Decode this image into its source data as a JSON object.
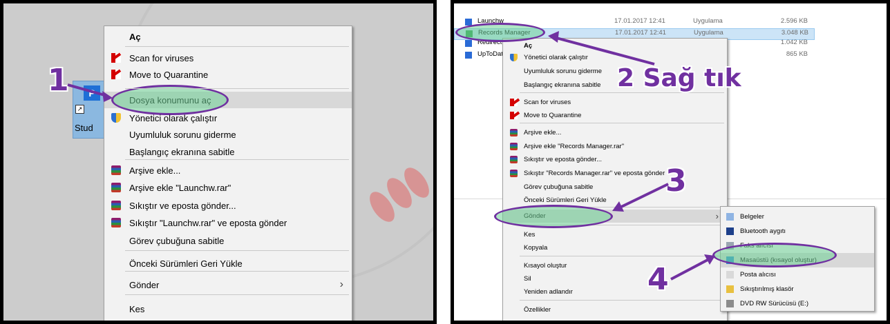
{
  "left": {
    "step": "1",
    "desktop_icon": {
      "label": "Stud",
      "tile_letter": "P"
    },
    "menu_items": [
      {
        "label": "Aç",
        "bold": true,
        "icon": null
      },
      {
        "label": "Scan for viruses",
        "icon": "kaspersky-icon"
      },
      {
        "label": "Move to Quarantine",
        "icon": "kaspersky-icon"
      },
      {
        "label": "Dosya konumunu aç",
        "icon": null,
        "highlight": true
      },
      {
        "label": "Yönetici olarak çalıştır",
        "icon": "shield-icon"
      },
      {
        "label": "Uyumluluk sorunu giderme",
        "icon": null
      },
      {
        "label": "Başlangıç ekranına sabitle",
        "icon": null
      },
      {
        "label": "Arşive ekle...",
        "icon": "winrar-icon"
      },
      {
        "label": "Arşive ekle \"Launchw.rar\"",
        "icon": "winrar-icon"
      },
      {
        "label": "Sıkıştır ve eposta gönder...",
        "icon": "winrar-icon"
      },
      {
        "label": "Sıkıştır \"Launchw.rar\" ve eposta gönder",
        "icon": "winrar-icon"
      },
      {
        "label": "Görev çubuğuna sabitle",
        "icon": null
      },
      {
        "label": "Önceki Sürümleri Geri Yükle",
        "icon": null
      },
      {
        "label": "Gönder",
        "icon": null,
        "submenu": true
      },
      {
        "label": "Kes",
        "icon": null
      }
    ]
  },
  "right": {
    "step2": "2 Sağ tık",
    "step3": "3",
    "step4": "4",
    "files": [
      {
        "name": "Launchw",
        "date": "17.01.2017 12:41",
        "type": "Uygulama",
        "size": "2.596 KB"
      },
      {
        "name": "Records Manager",
        "date": "17.01.2017 12:41",
        "type": "Uygulama",
        "size": "3.048 KB",
        "selected": true
      },
      {
        "name": "Redirect",
        "date": "",
        "type": "a",
        "size": "1.042 KB"
      },
      {
        "name": "UpToDat",
        "date": "",
        "type": "a",
        "size": "865 KB"
      }
    ],
    "menu_items": [
      {
        "label": "Aç",
        "bold": true
      },
      {
        "label": "Yönetici olarak çalıştır",
        "icon": "shield-icon"
      },
      {
        "label": "Uyumluluk sorunu giderme"
      },
      {
        "label": "Başlangıç ekranına sabitle"
      },
      {
        "label": "Scan for viruses",
        "icon": "kaspersky-icon"
      },
      {
        "label": "Move to Quarantine",
        "icon": "kaspersky-icon"
      },
      {
        "label": "Arşive ekle...",
        "icon": "winrar-icon"
      },
      {
        "label": "Arşive ekle \"Records Manager.rar\"",
        "icon": "winrar-icon"
      },
      {
        "label": "Sıkıştır ve eposta gönder...",
        "icon": "winrar-icon"
      },
      {
        "label": "Sıkıştır \"Records Manager.rar\" ve eposta gönder",
        "icon": "winrar-icon"
      },
      {
        "label": "Görev çubuğuna sabitle"
      },
      {
        "label": "Önceki Sürümleri Geri Yükle"
      },
      {
        "label": "Gönder",
        "submenu": true
      },
      {
        "label": "Kes"
      },
      {
        "label": "Kopyala"
      },
      {
        "label": "Kısayol oluştur"
      },
      {
        "label": "Sil"
      },
      {
        "label": "Yeniden adlandır"
      },
      {
        "label": "Özellikler"
      }
    ],
    "send_to": [
      {
        "label": "Belgeler",
        "icon": "documents-icon"
      },
      {
        "label": "Bluetooth aygıtı",
        "icon": "bluetooth-icon"
      },
      {
        "label": "Faks alıcısı",
        "icon": "fax-icon"
      },
      {
        "label": "Masaüstü (kısayol oluştur)",
        "icon": "desktop-icon",
        "highlight": true
      },
      {
        "label": "Posta alıcısı",
        "icon": "mail-icon"
      },
      {
        "label": "Sıkıştırılmış klasör",
        "icon": "zip-folder-icon"
      },
      {
        "label": "DVD RW Sürücüsü (E:)",
        "icon": "dvd-drive-icon"
      }
    ]
  },
  "colors": {
    "annotation": "#7030a0",
    "highlight_fill": "#6ed296",
    "menu_bg": "#f2f2f2"
  }
}
